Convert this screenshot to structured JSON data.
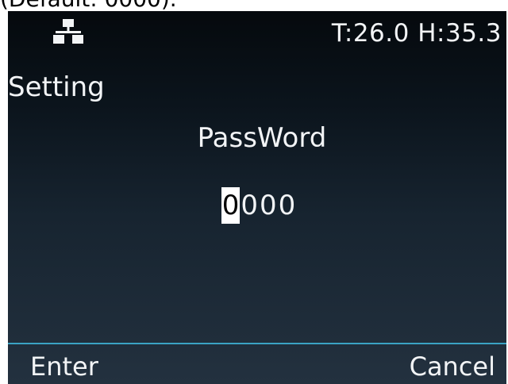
{
  "caption": "(Default: 0000).",
  "status": {
    "network_icon": "network-icon",
    "sensor_text": "T:26.0 H:35.3"
  },
  "menu": {
    "title": "Setting"
  },
  "password": {
    "label": "PassWord",
    "digits": [
      "0",
      "0",
      "0",
      "0"
    ],
    "active_index": 0
  },
  "softkeys": {
    "left": "Enter",
    "right": "Cancel"
  },
  "colors": {
    "divider": "#3aa3c4",
    "text": "#f2f4f6",
    "cursor_bg": "#ffffff"
  }
}
